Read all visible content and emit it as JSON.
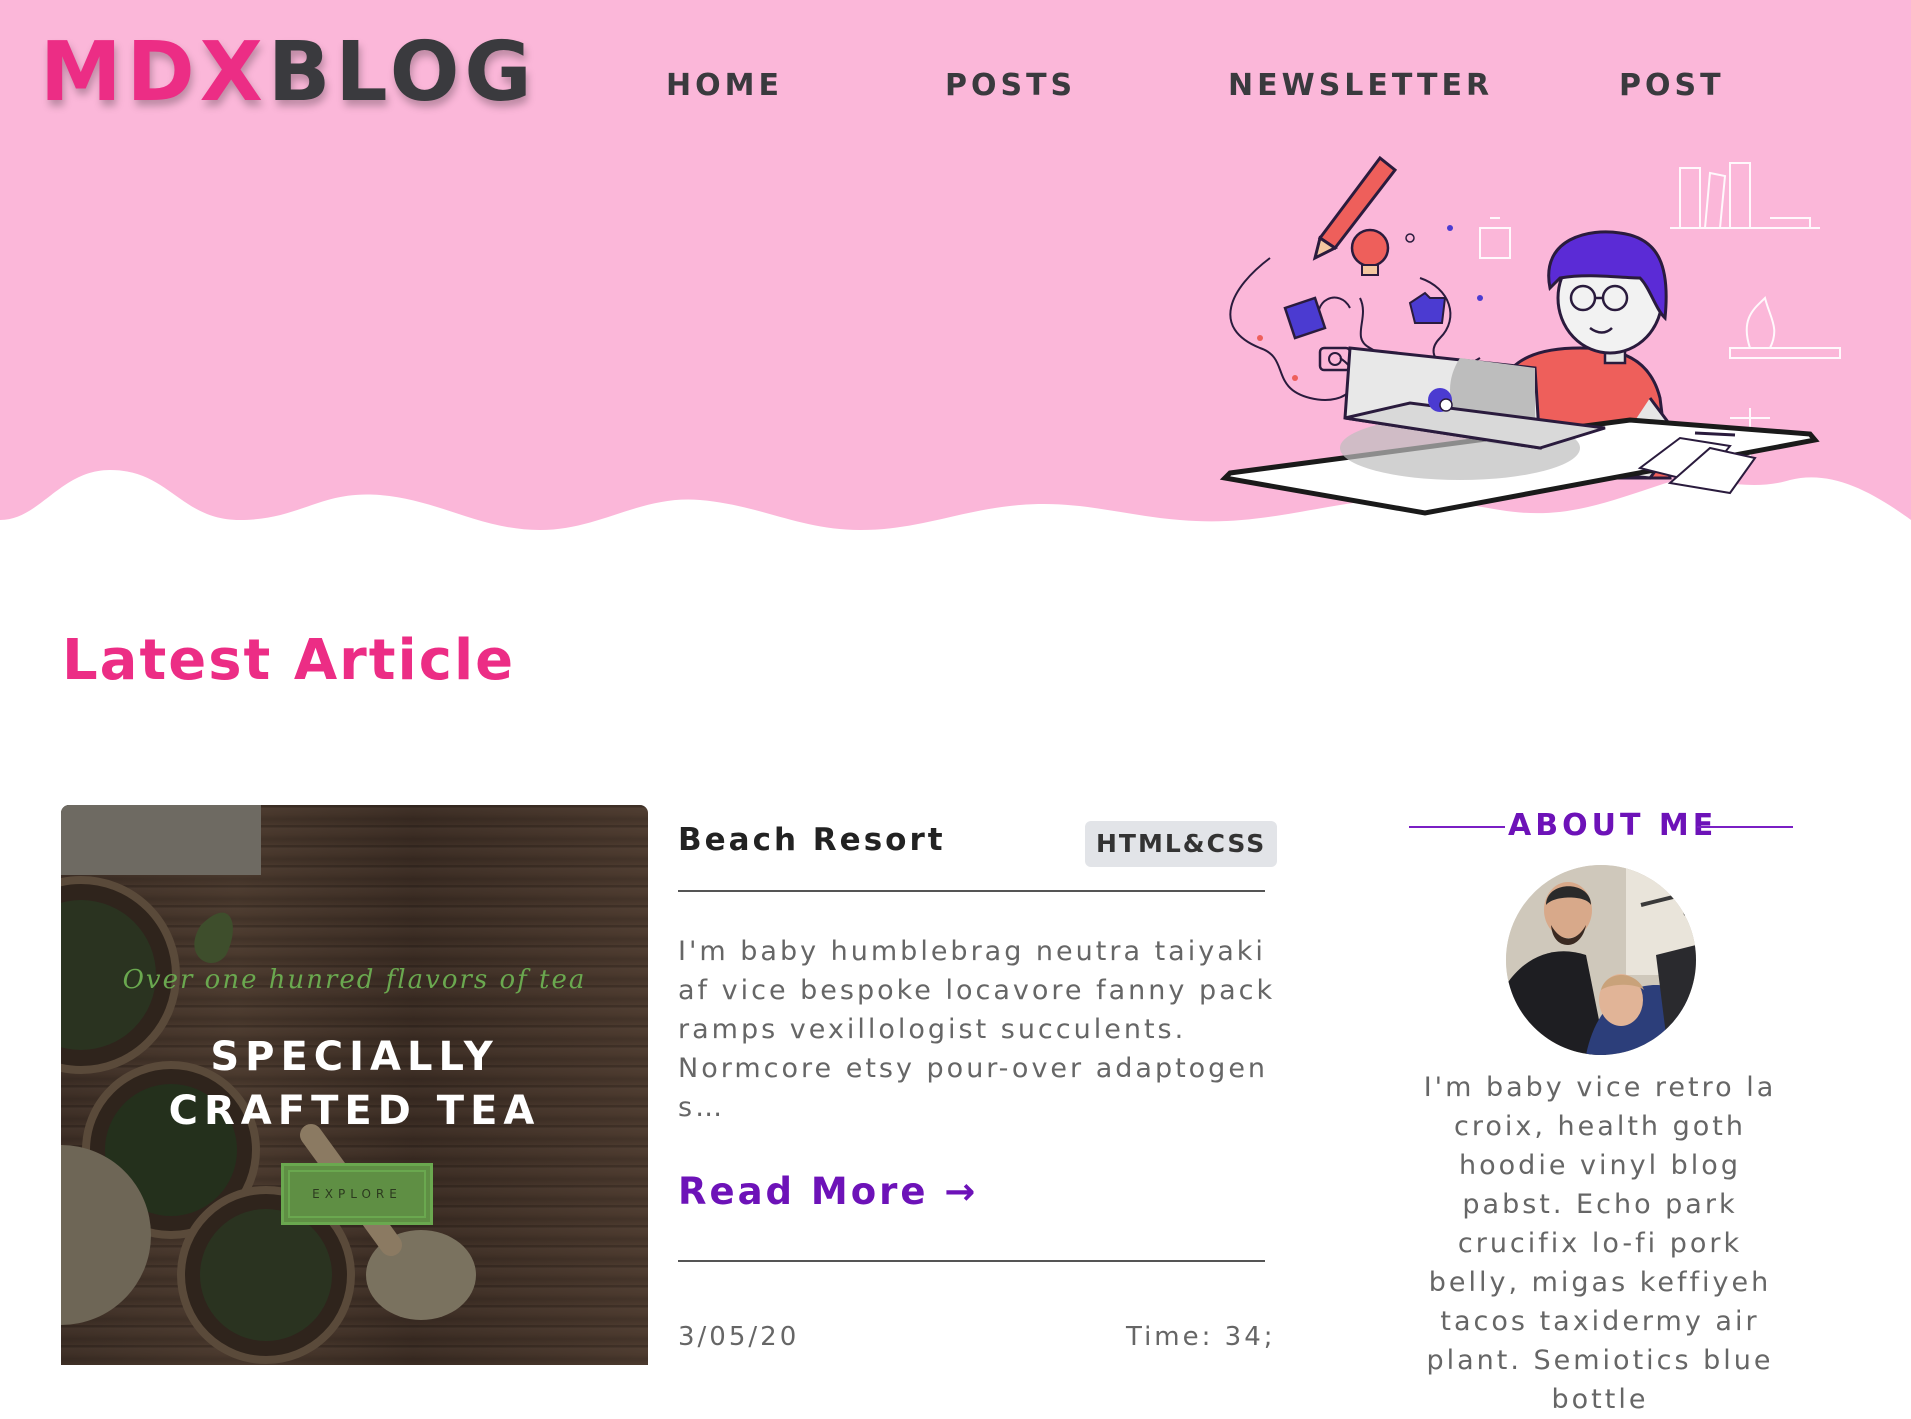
{
  "brand": {
    "part1": "MDX",
    "part2": "BLOG"
  },
  "nav": {
    "home": "HOME",
    "posts": "POSTS",
    "newsletter": "NEWSLETTER",
    "post": "POST"
  },
  "section": {
    "title": "Latest Article"
  },
  "article": {
    "thumbnail": {
      "tagline": "Over one hunred flavors of tea",
      "headline": "SPECIALLY CRAFTED TEA",
      "button": "EXPLORE"
    },
    "title": "Beach Resort",
    "tag": "HTML&CSS",
    "excerpt": "I'm baby humblebrag neutra taiyaki af vice bespoke locavore fanny pack ramps vexillologist succulents. Normcore etsy pour-over adaptogen s…",
    "read_more": "Read More →",
    "date": "3/05/20",
    "time": "Time: 34;"
  },
  "about": {
    "title": "ABOUT ME",
    "text": "I'm baby vice retro la croix, health goth hoodie vinyl blog pabst. Echo park crucifix lo-fi pork belly, migas keffiyeh tacos taxidermy air plant. Semiotics blue bottle"
  },
  "colors": {
    "hero_pink": "#fbb7d9",
    "brand_pink": "#ec2d85",
    "dark_text": "#3a3a3e",
    "accent_purple": "#6d12b8"
  }
}
